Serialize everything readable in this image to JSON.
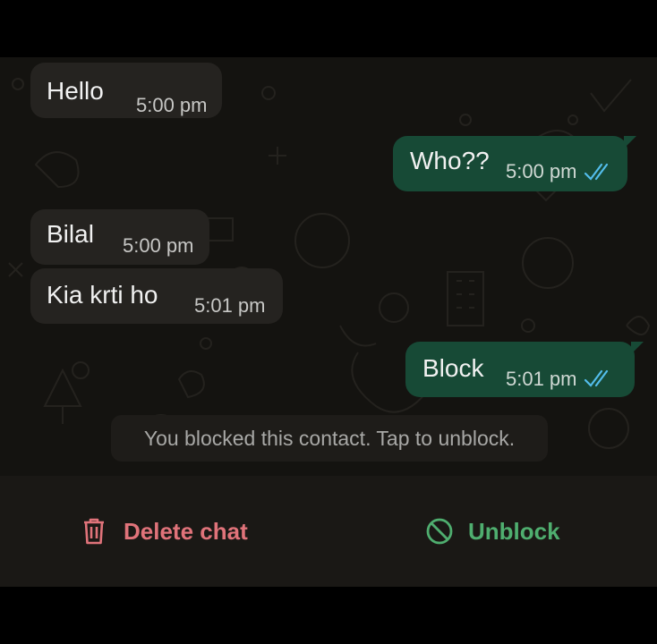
{
  "messages": [
    {
      "direction": "incoming",
      "text": "Hello",
      "time": "5:00 pm"
    },
    {
      "direction": "outgoing",
      "text": "Who??",
      "time": "5:00 pm",
      "status": "read-double-check"
    },
    {
      "direction": "incoming",
      "text": "Bilal",
      "time": "5:00 pm"
    },
    {
      "direction": "incoming",
      "text": "Kia krti ho",
      "time": "5:01 pm"
    },
    {
      "direction": "outgoing",
      "text": "Block",
      "time": "5:01 pm",
      "status": "read-double-check"
    }
  ],
  "system_message": "You blocked this contact. Tap to unblock.",
  "actions": {
    "delete_label": "Delete chat",
    "delete_icon": "trash-icon",
    "unblock_label": "Unblock",
    "unblock_icon": "block-icon"
  },
  "colors": {
    "incoming_bubble": "#252320",
    "outgoing_bubble": "#174a36",
    "read_ticks": "#53bdeb",
    "delete": "#e0737a",
    "unblock": "#4fae6f",
    "chat_background": "#141310"
  }
}
